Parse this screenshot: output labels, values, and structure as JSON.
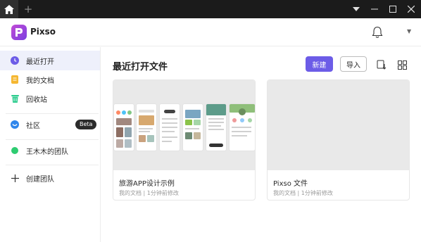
{
  "titlebar": {
    "home_icon": "home-icon",
    "new_tab_label": "+",
    "controls": [
      "dropdown-icon",
      "minimize-icon",
      "maximize-icon",
      "close-icon"
    ]
  },
  "header": {
    "brand": "Pixso",
    "bell_icon": "bell-icon",
    "menu_icon": "chevron-down-icon"
  },
  "sidebar": {
    "items": [
      {
        "label": "最近打开",
        "icon": "clock-icon",
        "color": "#6c5ce7"
      },
      {
        "label": "我的文档",
        "icon": "document-icon",
        "color": "#f5b731"
      },
      {
        "label": "回收站",
        "icon": "trash-icon",
        "color": "#2ecc8f"
      },
      {
        "label": "社区",
        "icon": "community-icon",
        "color": "#2f86eb"
      },
      {
        "label": "王木木的团队",
        "icon": "team-dot-icon",
        "color": "#2ecc71"
      },
      {
        "label": "创建团队",
        "icon": "plus-icon",
        "color": "#333333"
      }
    ],
    "beta_badge": "Beta"
  },
  "main": {
    "title": "最近打开文件",
    "new_button": "新建",
    "import_button": "导入",
    "sort_icon": "sort-icon",
    "grid_icon": "grid-view-icon",
    "files": [
      {
        "title": "旅游APP设计示例",
        "meta": "我的文档 | 1分钟前修改"
      },
      {
        "title": "Pixso 文件",
        "meta": "我的文档 | 1分钟前修改"
      }
    ]
  },
  "colors": {
    "accent": "#6c5ce7",
    "titlebar": "#1b1b1b",
    "active_bg": "#eef0fb"
  }
}
